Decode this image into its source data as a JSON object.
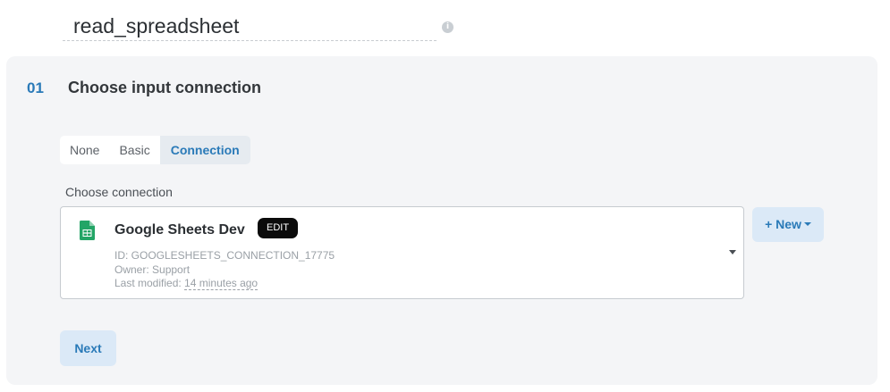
{
  "step_name": {
    "value": "read_spreadsheet",
    "info_icon": "info-icon"
  },
  "section": {
    "number": "01",
    "title": "Choose input connection"
  },
  "auth_tabs": {
    "items": [
      "None",
      "Basic",
      "Connection"
    ],
    "selected": "Connection"
  },
  "connection": {
    "label": "Choose connection",
    "name": "Google Sheets Dev",
    "edit_label": "EDIT",
    "icon": "google-sheets-icon",
    "id_line": "ID: GOOGLESHEETS_CONNECTION_17775",
    "owner_line": "Owner: Support",
    "modified_prefix": "Last modified: ",
    "modified_ago": "14 minutes ago"
  },
  "new_button": {
    "label": "+ New"
  },
  "next_button": {
    "label": "Next"
  },
  "colors": {
    "accent": "#2a7ab8",
    "panel_bg": "#f4f5f7",
    "button_bg": "#dbe9f7",
    "sheets_green": "#23a566"
  }
}
